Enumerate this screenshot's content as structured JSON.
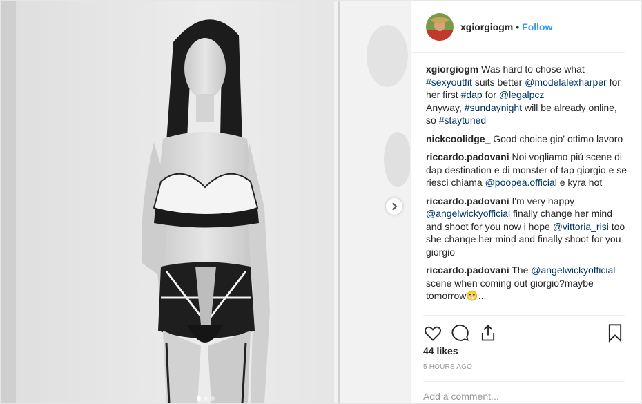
{
  "author": {
    "username": "xgiorgiogm",
    "separator": "•",
    "follow_label": "Follow"
  },
  "caption": {
    "username": "xgiorgiogm",
    "parts": [
      {
        "t": "Was hard to chose what ",
        "link": false
      },
      {
        "t": "#sexyoutfit",
        "link": true
      },
      {
        "t": " suits better ",
        "link": false
      },
      {
        "t": "@modelalexharper",
        "link": true
      },
      {
        "t": " for her first ",
        "link": false
      },
      {
        "t": "#dap",
        "link": true
      },
      {
        "t": " for ",
        "link": false
      },
      {
        "t": "@legalpcz",
        "link": true
      },
      {
        "br": true
      },
      {
        "t": "Anyway, ",
        "link": false
      },
      {
        "t": "#sundaynight",
        "link": true
      },
      {
        "t": " will be already online, so ",
        "link": false
      },
      {
        "t": "#staytuned",
        "link": true
      }
    ]
  },
  "comments": [
    {
      "username": "nickcoolidge_",
      "parts": [
        {
          "t": "Good choice gio' ottimo lavoro",
          "link": false
        }
      ]
    },
    {
      "username": "riccardo.padovani",
      "parts": [
        {
          "t": "Noi vogliamo piú scene di dap destination e di monster of tap giorgio e se riesci chiama ",
          "link": false
        },
        {
          "t": "@poopea.official",
          "link": true
        },
        {
          "t": " e kyra hot",
          "link": false
        }
      ]
    },
    {
      "username": "riccardo.padovani",
      "parts": [
        {
          "t": "I'm very happy ",
          "link": false
        },
        {
          "t": "@angelwickyofficial",
          "link": true
        },
        {
          "t": " finally change her mind and shoot for you now i hope ",
          "link": false
        },
        {
          "t": "@vittoria_risi",
          "link": true
        },
        {
          "t": " too she change her mind and finally shoot for you giorgio",
          "link": false
        }
      ]
    },
    {
      "username": "riccardo.padovani",
      "parts": [
        {
          "t": "The ",
          "link": false
        },
        {
          "t": "@angelwickyofficial",
          "link": true
        },
        {
          "t": " scene when coming out giorgio?maybe tomorrow😁...",
          "link": false
        }
      ]
    }
  ],
  "actions": {
    "icons": [
      "heart-icon",
      "comment-icon",
      "share-icon",
      "bookmark-icon"
    ]
  },
  "likes_text": "44 likes",
  "timestamp": "5 HOURS AGO",
  "add_comment": {
    "placeholder": "Add a comment..."
  },
  "carousel": {
    "slides": 3,
    "active": 0,
    "next_icon": "chevron-right-icon"
  }
}
